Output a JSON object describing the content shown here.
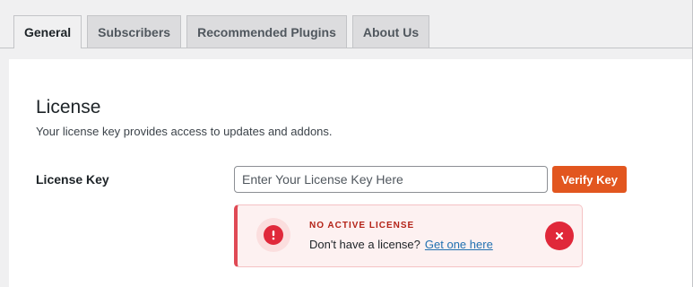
{
  "tabs": [
    {
      "label": "General",
      "active": true
    },
    {
      "label": "Subscribers",
      "active": false
    },
    {
      "label": "Recommended Plugins",
      "active": false
    },
    {
      "label": "About Us",
      "active": false
    }
  ],
  "license_section": {
    "title": "License",
    "description": "Your license key provides access to updates and addons.",
    "field_label": "License Key",
    "input_value": "",
    "input_placeholder": "Enter Your License Key Here",
    "verify_button": "Verify Key"
  },
  "notice": {
    "title": "NO ACTIVE LICENSE",
    "text": "Don't have a license?",
    "link_text": "Get one here",
    "icon": "exclamation-icon",
    "dismiss_icon": "close-icon"
  },
  "colors": {
    "accent": "#e2561f",
    "error": "#e0283a",
    "link": "#2271b1"
  }
}
